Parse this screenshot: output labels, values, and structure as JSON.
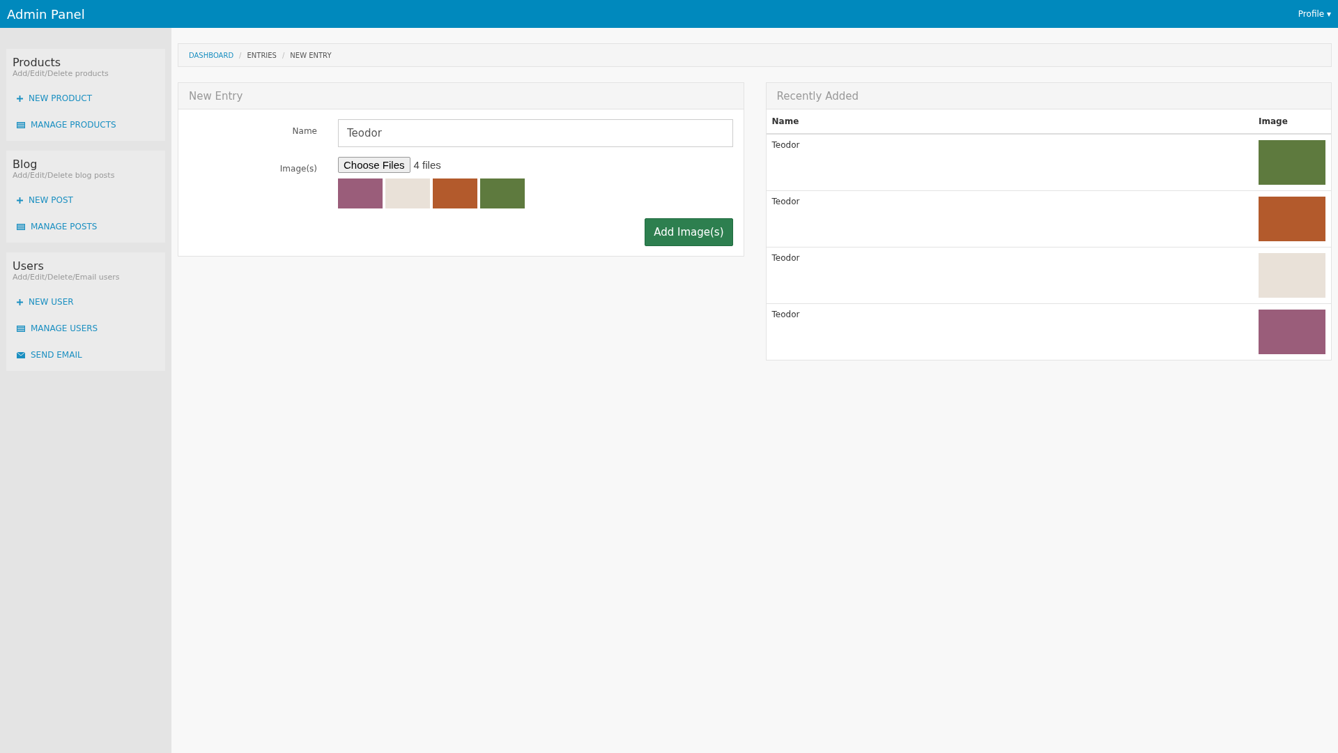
{
  "navbar": {
    "brand": "Admin Panel",
    "profile": "Profile ▾"
  },
  "sidebar": {
    "sections": [
      {
        "title": "Products",
        "subtitle": "Add/Edit/Delete products",
        "items": [
          {
            "label": "NEW PRODUCT",
            "kind": "add"
          },
          {
            "label": "MANAGE PRODUCTS",
            "kind": "list"
          }
        ]
      },
      {
        "title": "Blog",
        "subtitle": "Add/Edit/Delete blog posts",
        "items": [
          {
            "label": "NEW POST",
            "kind": "add"
          },
          {
            "label": "MANAGE POSTS",
            "kind": "list"
          }
        ]
      },
      {
        "title": "Users",
        "subtitle": "Add/Edit/Delete/Email users",
        "items": [
          {
            "label": "NEW USER",
            "kind": "add"
          },
          {
            "label": "MANAGE USERS",
            "kind": "list"
          },
          {
            "label": "SEND EMAIL",
            "kind": "mail"
          }
        ]
      }
    ]
  },
  "breadcrumb": [
    {
      "label": "DASHBOARD",
      "kind": "link"
    },
    {
      "label": "ENTRIES",
      "kind": "text"
    },
    {
      "label": "NEW ENTRY",
      "kind": "text"
    }
  ],
  "breadcrumb_separator": "/",
  "new_entry": {
    "title": "New Entry",
    "name_label": "Name",
    "name_value": "Teodor",
    "images_label": "Image(s)",
    "choose_button": "Choose Files",
    "file_count": "4 files",
    "previews": [
      {
        "kind": "photo"
      },
      {
        "kind": "photo"
      },
      {
        "kind": "photo"
      },
      {
        "kind": "photo"
      }
    ],
    "submit": "Add Image(s)"
  },
  "recently_added": {
    "title": "Recently Added",
    "columns": [
      "Name",
      "Image"
    ],
    "rows": [
      {
        "name": "Teodor"
      },
      {
        "name": "Teodor"
      },
      {
        "name": "Teodor"
      },
      {
        "name": "Teodor"
      }
    ]
  }
}
